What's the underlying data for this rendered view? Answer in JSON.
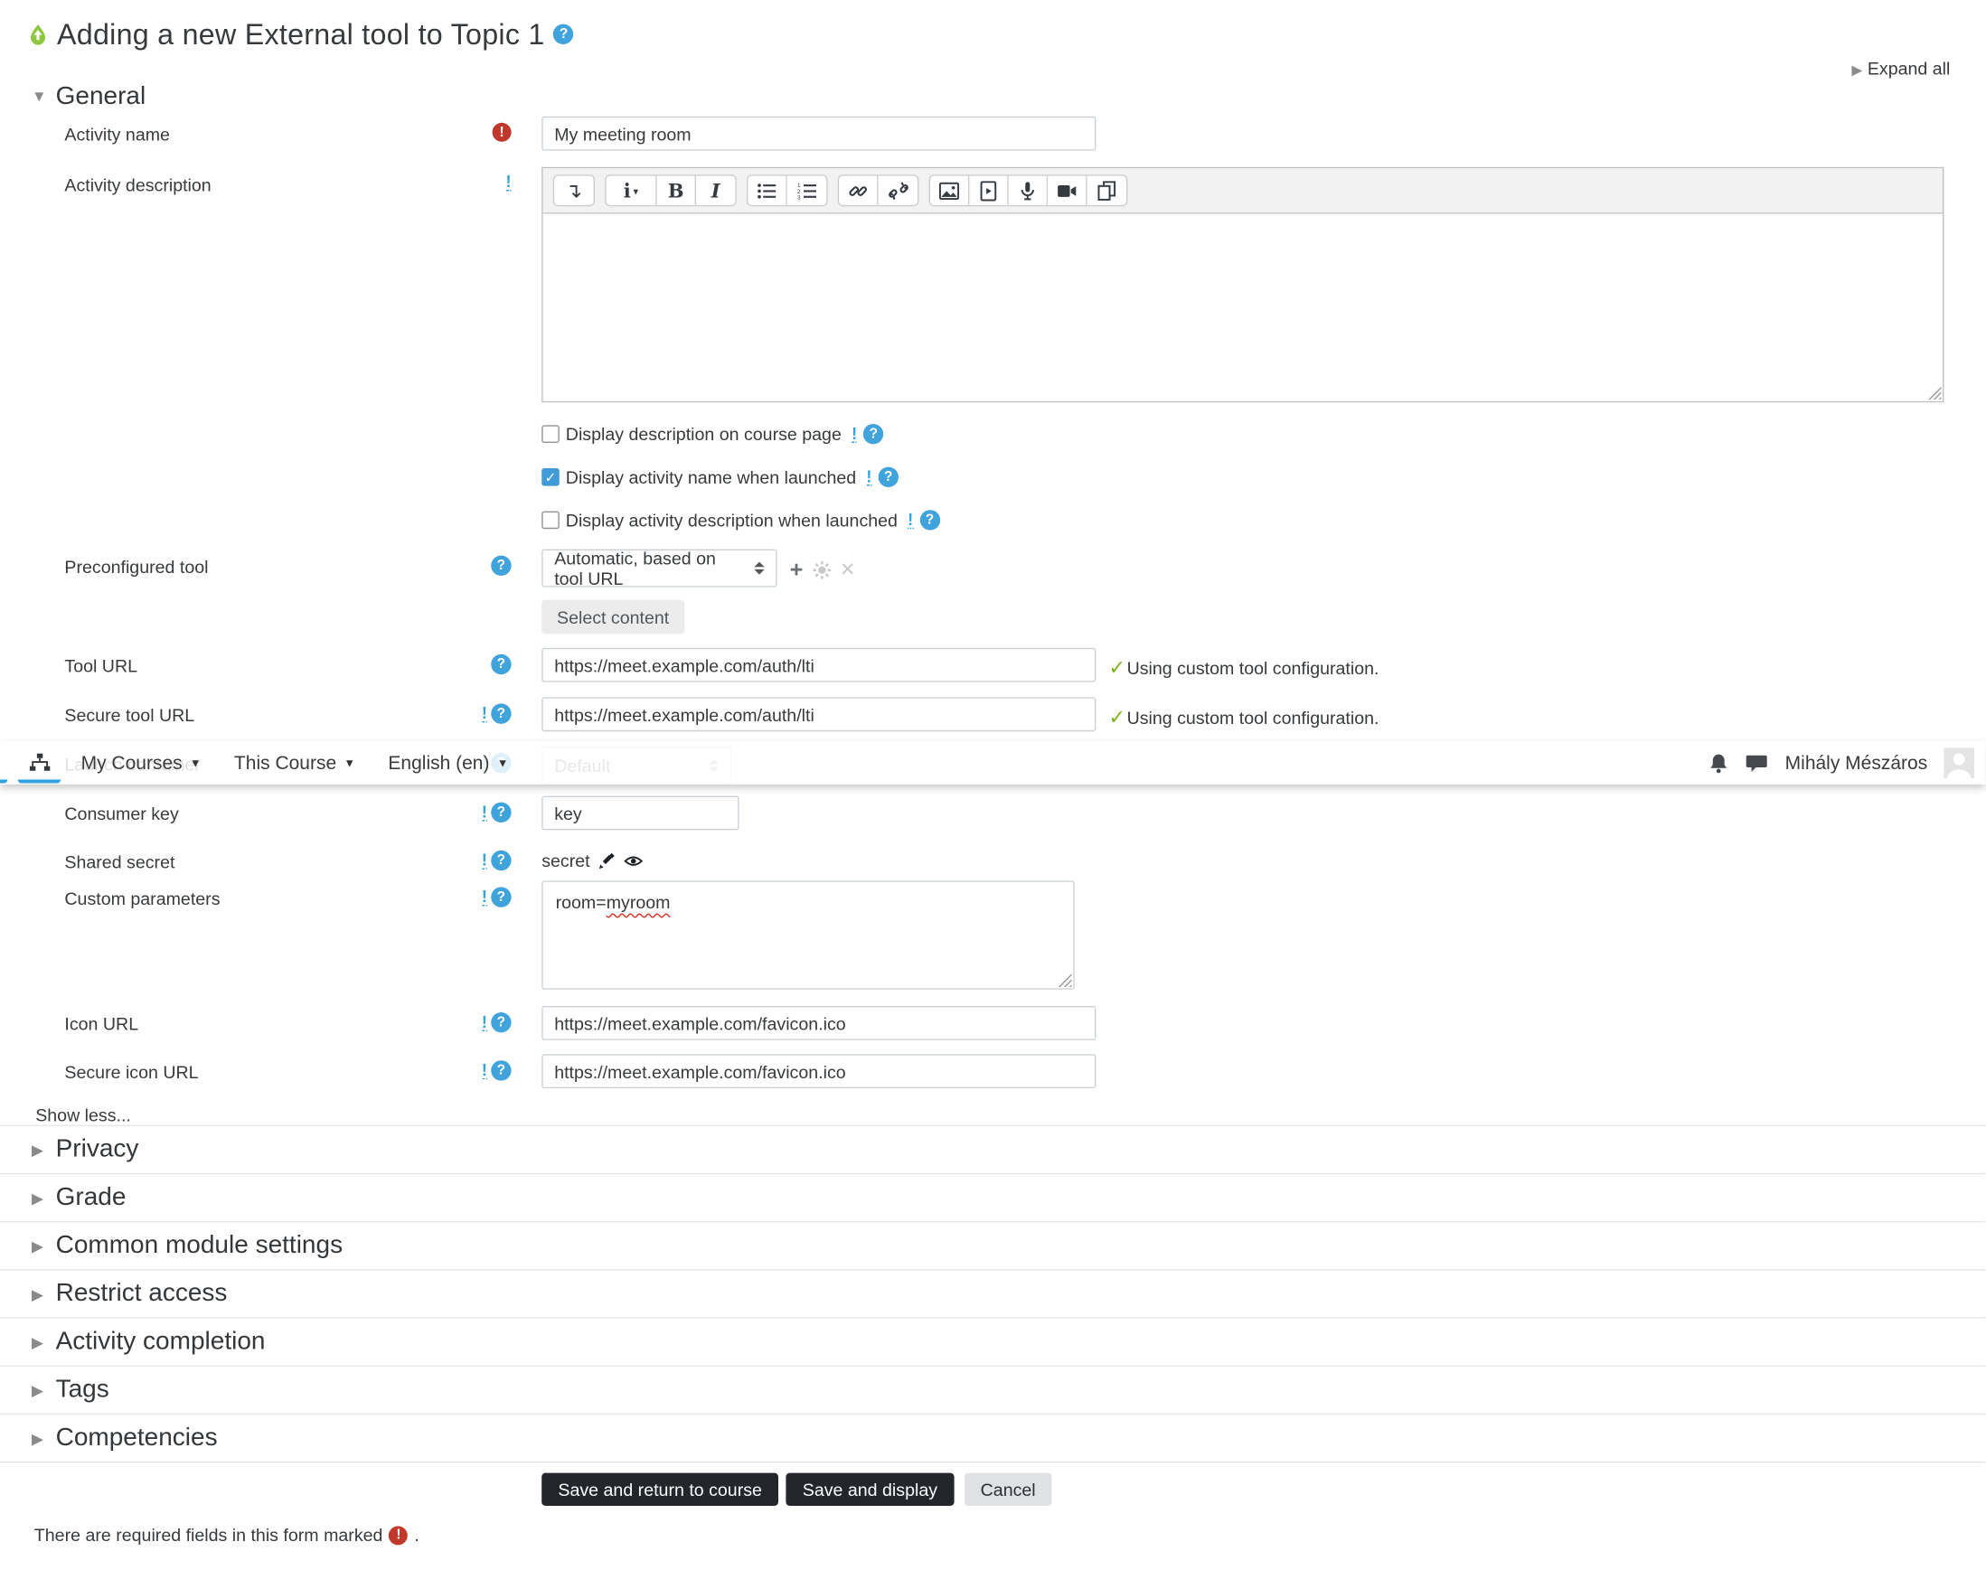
{
  "page": {
    "title": "Adding a new External tool to Topic 1",
    "expand_all": "Expand all"
  },
  "navbar": {
    "items": [
      "My Courses",
      "This Course",
      "English (en)"
    ],
    "user_name": "Mihály Mészáros",
    "icons": [
      "sitemap-icon",
      "bell-icon",
      "messages-icon",
      "avatar"
    ]
  },
  "general": {
    "heading": "General",
    "activity_name": {
      "label": "Activity name",
      "value": "My meeting room"
    },
    "activity_description": {
      "label": "Activity description"
    },
    "editor_toolbar_icons": [
      "toolbar-toggle",
      "styles-menu",
      "bold",
      "italic",
      "bullet-list",
      "numbered-list",
      "link",
      "unlink",
      "image",
      "media",
      "record-audio",
      "record-video",
      "manage-files"
    ],
    "checkboxes": [
      {
        "label": "Display description on course page",
        "checked": false
      },
      {
        "label": "Display activity name when launched",
        "checked": true
      },
      {
        "label": "Display activity description when launched",
        "checked": false
      }
    ],
    "preconfigured_tool": {
      "label": "Preconfigured tool",
      "value": "Automatic, based on tool URL",
      "button": "Select content"
    },
    "tool_url": {
      "label": "Tool URL",
      "value": "https://meet.example.com/auth/lti",
      "status": "Using custom tool configuration."
    },
    "secure_tool_url": {
      "label": "Secure tool URL",
      "value": "https://meet.example.com/auth/lti",
      "status": "Using custom tool configuration."
    },
    "launch_container": {
      "label": "Launch container",
      "value": "Default"
    },
    "consumer_key": {
      "label": "Consumer key",
      "value": "key"
    },
    "shared_secret": {
      "label": "Shared secret",
      "value": "secret"
    },
    "custom_parameters": {
      "label": "Custom parameters",
      "value_prefix": "room=",
      "value_misspelled": "myroom"
    },
    "icon_url": {
      "label": "Icon URL",
      "value": "https://meet.example.com/favicon.ico"
    },
    "secure_icon_url": {
      "label": "Secure icon URL",
      "value": "https://meet.example.com/favicon.ico"
    },
    "show_less": "Show less..."
  },
  "collapsed_sections": [
    "Privacy",
    "Grade",
    "Common module settings",
    "Restrict access",
    "Activity completion",
    "Tags",
    "Competencies"
  ],
  "actions": {
    "save_return": "Save and return to course",
    "save_display": "Save and display",
    "cancel": "Cancel"
  },
  "footer": {
    "required_note_before": "There are required fields in this form marked",
    "required_note_after": "."
  },
  "colors": {
    "help_icon_bg": "#41a3dc",
    "required_icon_bg": "#c0392b",
    "checkbox_checked": "#419bd8",
    "success_check": "#7cb41f",
    "primary_button_bg": "#23262b",
    "nav_active_tab": "#31a2e0",
    "tool_icon_green": "#8dc63f"
  }
}
